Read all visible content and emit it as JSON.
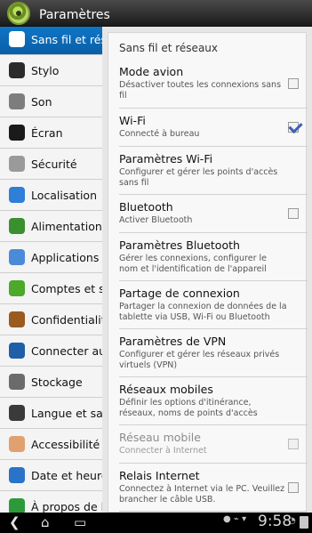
{
  "header": {
    "title": "Paramètres"
  },
  "sidebar": {
    "items": [
      {
        "label": "Sans fil et rés",
        "icon": "wireless-icon",
        "selected": true,
        "color": "#0a6abf"
      },
      {
        "label": "Stylo",
        "icon": "stylus-icon",
        "selected": false,
        "color": "#2b2b2b"
      },
      {
        "label": "Son",
        "icon": "sound-icon",
        "selected": false,
        "color": "#7d7d7d"
      },
      {
        "label": "Écran",
        "icon": "screen-icon",
        "selected": false,
        "color": "#1a1a1a"
      },
      {
        "label": "Sécurité",
        "icon": "lock-icon",
        "selected": false,
        "color": "#9a9a9a"
      },
      {
        "label": "Localisation",
        "icon": "location-icon",
        "selected": false,
        "color": "#2f7ed8"
      },
      {
        "label": "Alimentation",
        "icon": "battery-icon",
        "selected": false,
        "color": "#3a8f2e"
      },
      {
        "label": "Applications",
        "icon": "apps-icon",
        "selected": false,
        "color": "#4a8bd8"
      },
      {
        "label": "Comptes et sy",
        "icon": "sync-icon",
        "selected": false,
        "color": "#4ea82a"
      },
      {
        "label": "Confidentialité",
        "icon": "privacy-icon",
        "selected": false,
        "color": "#9a5a20"
      },
      {
        "label": "Connecter au",
        "icon": "pc-connect-icon",
        "selected": false,
        "color": "#1f5fa8"
      },
      {
        "label": "Stockage",
        "icon": "storage-icon",
        "selected": false,
        "color": "#6b6b6b"
      },
      {
        "label": "Langue et sais",
        "icon": "language-icon",
        "selected": false,
        "color": "#3a3a3a"
      },
      {
        "label": "Accessibilité",
        "icon": "hand-icon",
        "selected": false,
        "color": "#e0a070"
      },
      {
        "label": "Date et heure",
        "icon": "clock-globe-icon",
        "selected": false,
        "color": "#2a73c8"
      },
      {
        "label": "À propos de la",
        "icon": "info-icon",
        "selected": false,
        "color": "#2c9a3a"
      }
    ]
  },
  "main": {
    "title": "Sans fil et réseaux",
    "settings": [
      {
        "title": "Mode avion",
        "subtitle": "Désactiver toutes les connexions sans fil",
        "checkbox": "unchecked",
        "disabled": false
      },
      {
        "title": "Wi-Fi",
        "subtitle": "Connecté à bureau",
        "checkbox": "checked",
        "disabled": false
      },
      {
        "title": "Paramètres Wi-Fi",
        "subtitle": "Configurer et gérer les points d'accès sans fil",
        "checkbox": null,
        "disabled": false
      },
      {
        "title": "Bluetooth",
        "subtitle": "Activer Bluetooth",
        "checkbox": "unchecked",
        "disabled": false
      },
      {
        "title": "Paramètres Bluetooth",
        "subtitle": "Gérer les connexions, configurer le nom et l'identification de l'appareil",
        "checkbox": null,
        "disabled": false
      },
      {
        "title": "Partage de connexion",
        "subtitle": "Partager la connexion de données de la tablette via USB, Wi-Fi ou Bluetooth",
        "checkbox": null,
        "disabled": false
      },
      {
        "title": "Paramètres de VPN",
        "subtitle": "Configurer et gérer les réseaux privés virtuels (VPN)",
        "checkbox": null,
        "disabled": false
      },
      {
        "title": "Réseaux mobiles",
        "subtitle": "Définir les options d'itinérance, réseaux, noms de points d'accès",
        "checkbox": null,
        "disabled": false
      },
      {
        "title": "Réseau mobile",
        "subtitle": "Connecter à Internet",
        "checkbox": "unchecked",
        "disabled": true
      },
      {
        "title": "Relais Internet",
        "subtitle": "Connectez à Internet via le PC. Veuillez brancher le câble USB.",
        "checkbox": "unchecked",
        "disabled": false
      }
    ]
  },
  "navbar": {
    "clock": "9:58",
    "back_icon": "back-icon",
    "home_icon": "home-icon",
    "recent_icon": "recent-apps-icon"
  },
  "colors": {
    "selected": "#0a6abf",
    "check": "#3f5fb5"
  }
}
